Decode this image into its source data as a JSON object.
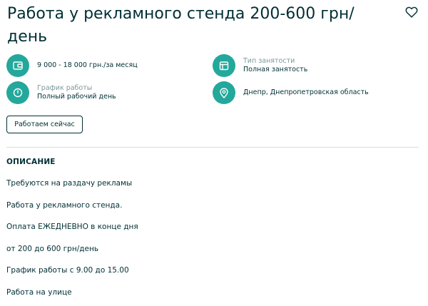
{
  "listing": {
    "title": "Работа у рекламного стенда 200-600 грн/ день"
  },
  "attributes": [
    {
      "label": "",
      "value": "9 000 - 18 000 грн./за месяц",
      "icon": "wallet-icon"
    },
    {
      "label": "График работы",
      "value": "Полный рабочий день",
      "icon": "clock-icon"
    },
    {
      "label": "Тип занятости",
      "value": "Полная занятость",
      "icon": "calendar-icon"
    },
    {
      "label": "",
      "value": "Днепр, Днепропетровская область",
      "icon": "location-pin-icon"
    }
  ],
  "actions": {
    "working_now_label": "Работаем сейчас"
  },
  "description": {
    "heading": "ОПИСАНИЕ",
    "lines": [
      "Требуются на раздачу рекламы",
      "Работа у рекламного стенда.",
      "Оплата ЕЖЕДНЕВНО в конце дня",
      "от 200 до 600 грн/день",
      "График работы с 9.00 до 15.00",
      "Работа на улице"
    ]
  },
  "colors": {
    "accent": "#23a89b",
    "text": "#002f34",
    "muted": "#7f9799"
  }
}
